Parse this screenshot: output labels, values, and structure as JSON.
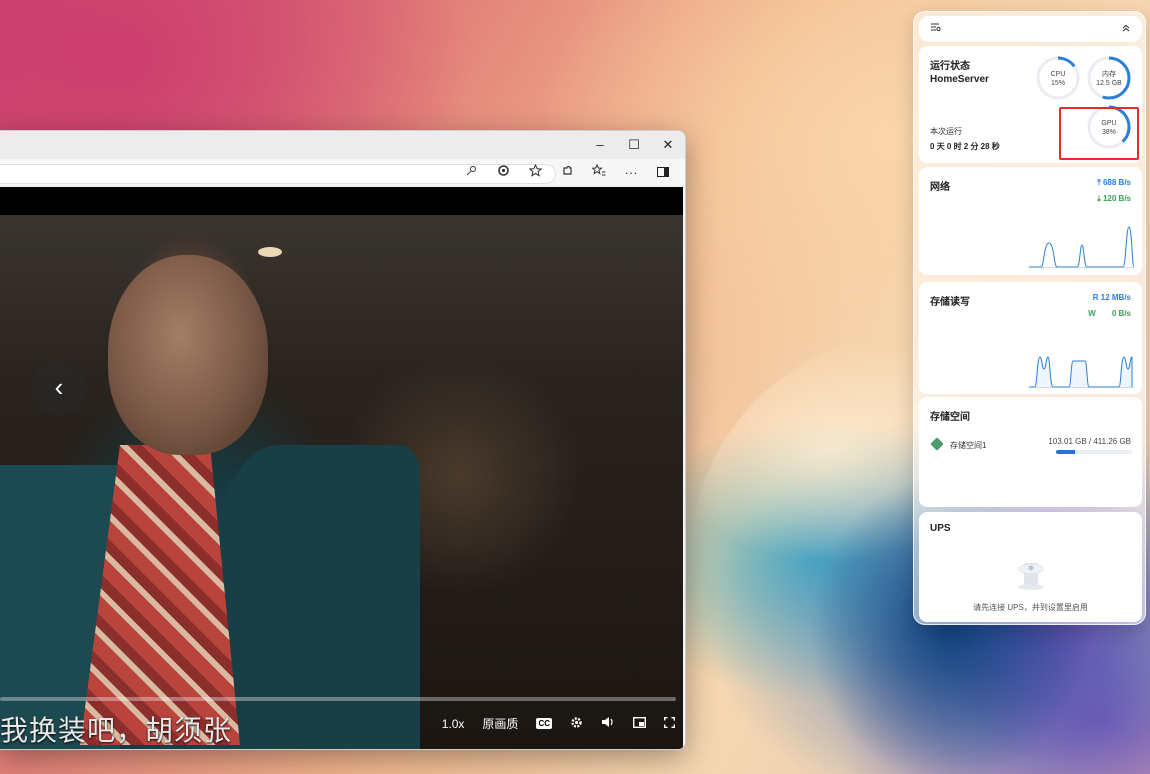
{
  "browser": {
    "window_controls": {
      "minimize": "–",
      "maximize": "☐",
      "close": "✕"
    },
    "toolbar_icons": [
      "key-icon",
      "refresh-icon",
      "star-icon",
      "extensions-icon",
      "favorites-icon",
      "more-icon",
      "sidebar-icon"
    ],
    "toolbar_more": "···"
  },
  "video": {
    "subtitle": "我换装吧，胡须张",
    "speed": "1.0x",
    "quality": "原画质",
    "cc_label": "CC"
  },
  "panel": {
    "status": {
      "title": "运行状态",
      "host": "HomeServer",
      "uptime_label": "本次运行",
      "uptime_value": "0 天 0 时 2 分 28 秒",
      "cpu": {
        "label": "CPU",
        "value": "15%",
        "fraction": 0.15
      },
      "memory": {
        "label": "内存",
        "value": "12.5 GB",
        "fraction": 0.55
      },
      "gpu": {
        "label": "GPU",
        "value": "38%",
        "fraction": 0.38
      }
    },
    "network": {
      "title": "网络",
      "up": "688 B/s",
      "down": "120 B/s"
    },
    "disk_io": {
      "title": "存储读写",
      "read_label": "R",
      "read": "12 MB/s",
      "write_label": "W",
      "write": "0 B/s"
    },
    "storage": {
      "title": "存储空间",
      "volume_name": "存储空间1",
      "usage": "103.01 GB / 411.26 GB",
      "used_fraction": 0.25
    },
    "ups": {
      "title": "UPS",
      "message": "请先连接 UPS，并到设置里启用"
    }
  },
  "colors": {
    "accent": "#2b7fd6",
    "highlight": "#e52b2b",
    "download": "#3aa35a"
  }
}
